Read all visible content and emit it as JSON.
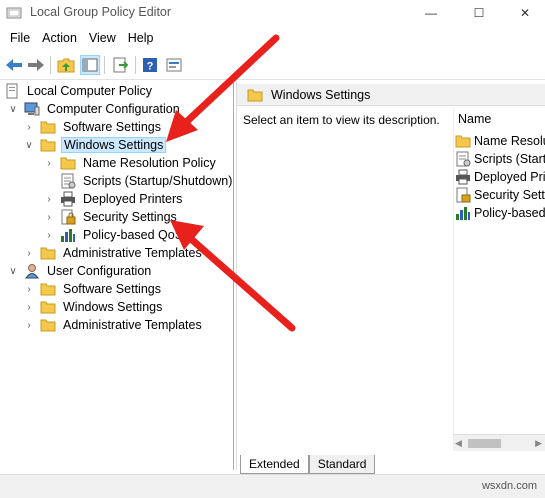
{
  "window": {
    "title": "Local Group Policy Editor",
    "minimize_glyph": "—",
    "maximize_glyph": "☐",
    "close_glyph": "✕"
  },
  "menu": [
    "File",
    "Action",
    "View",
    "Help"
  ],
  "toolbar": {
    "icons": [
      "back-arrow-icon",
      "forward-arrow-icon",
      "up-folder-icon",
      "show-hide-tree-icon",
      "export-list-icon",
      "help-icon",
      "properties-icon"
    ]
  },
  "tree": {
    "root": "Local Computer Policy",
    "computer_configuration": "Computer Configuration",
    "cc_children": {
      "software_settings": "Software Settings",
      "windows_settings": "Windows Settings",
      "administrative_templates": "Administrative Templates"
    },
    "ws_children": {
      "name_resolution_policy": "Name Resolution Policy",
      "scripts": "Scripts (Startup/Shutdown)",
      "deployed_printers": "Deployed Printers",
      "security_settings": "Security Settings",
      "policy_based_qos": "Policy-based QoS"
    },
    "user_configuration": "User Configuration",
    "uc_children": {
      "software_settings": "Software Settings",
      "windows_settings": "Windows Settings",
      "administrative_templates": "Administrative Templates"
    },
    "selected": "Windows Settings"
  },
  "right_pane": {
    "header": "Windows Settings",
    "description": "Select an item to view its description.",
    "column_name": "Name",
    "items": [
      "Name Resolut",
      "Scripts (Startu",
      "Deployed Print",
      "Security Settin",
      "Policy-based (",
      "Policy-based"
    ]
  },
  "tabs": {
    "extended": "Extended",
    "standard": "Standard",
    "active": "Extended"
  },
  "watermark": "wsxdn.com",
  "colors": {
    "selection": "#cce8ff",
    "arrow": "#e8211d",
    "folder": "#f5c84c"
  }
}
